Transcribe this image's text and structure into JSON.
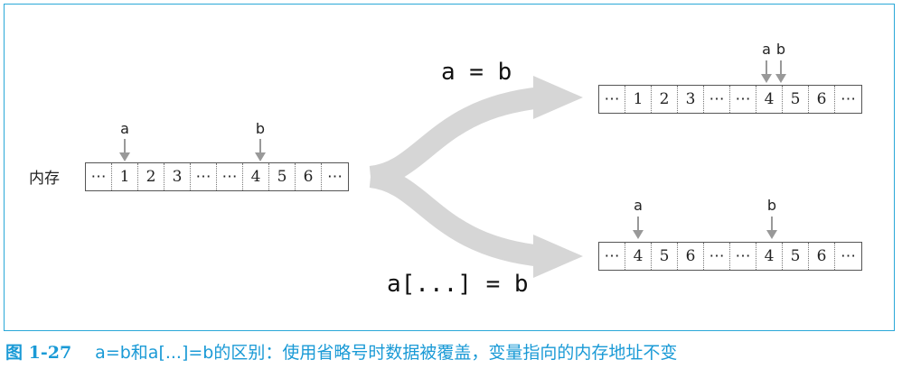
{
  "memory_label": "内存",
  "original_row": [
    "⋯",
    "1",
    "2",
    "3",
    "⋯",
    "⋯",
    "4",
    "5",
    "6",
    "⋯"
  ],
  "original_pointers": {
    "a": "a",
    "b": "b"
  },
  "top_result": {
    "operation": "a = b",
    "row": [
      "⋯",
      "1",
      "2",
      "3",
      "⋯",
      "⋯",
      "4",
      "5",
      "6",
      "⋯"
    ],
    "pointers": {
      "a": "a",
      "b": "b"
    }
  },
  "bottom_result": {
    "operation": "a[...] = b",
    "row": [
      "⋯",
      "4",
      "5",
      "6",
      "⋯",
      "⋯",
      "4",
      "5",
      "6",
      "⋯"
    ],
    "pointers": {
      "a": "a",
      "b": "b"
    }
  },
  "caption": {
    "figure_number": "图 1-27",
    "text": "a=b和a[...]=b的区别：使用省略号时数据被覆盖，变量指向的内存地址不变"
  },
  "colors": {
    "frame": "#2aa8d8",
    "caption": "#1a9ad6",
    "branch_arrow": "#d6d6d6",
    "pointer_arrow": "#999999"
  }
}
